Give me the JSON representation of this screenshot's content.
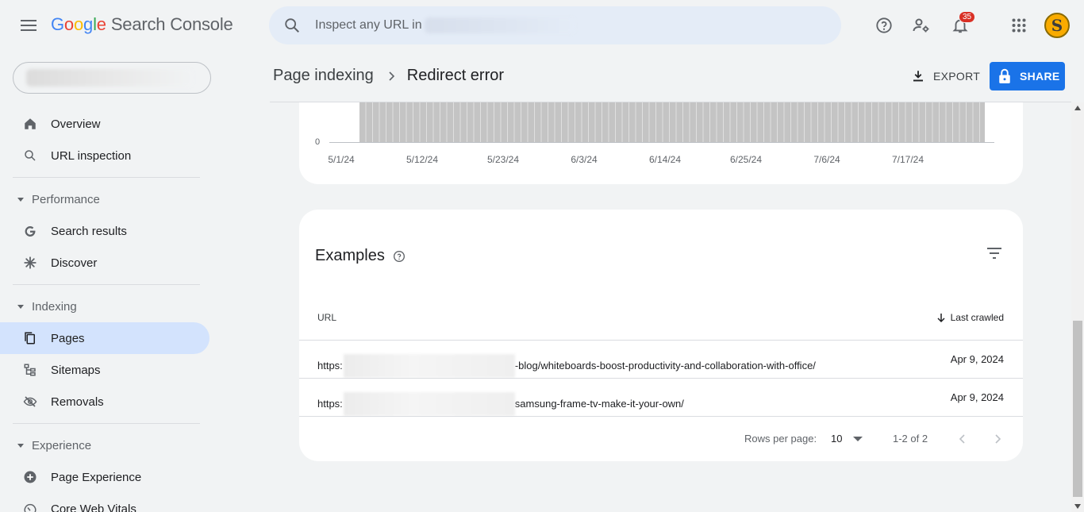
{
  "app": {
    "title_letters": [
      "G",
      "o",
      "o",
      "g",
      "l",
      "e"
    ],
    "product": "Search Console"
  },
  "search": {
    "placeholder": "Inspect any URL in"
  },
  "notifications": {
    "count": "35"
  },
  "avatar": {
    "initial": "S"
  },
  "icons": {
    "menu": "menu-icon",
    "search": "search-icon",
    "help": "help-icon",
    "account_settings": "manage-accounts-icon",
    "notifications": "bell-icon",
    "apps": "apps-grid-icon"
  },
  "sidebar": {
    "items": [
      {
        "label": "Overview",
        "icon": "home-icon"
      },
      {
        "label": "URL inspection",
        "icon": "search-icon"
      }
    ],
    "sections": [
      {
        "label": "Performance",
        "items": [
          {
            "label": "Search results",
            "icon": "google-g-icon"
          },
          {
            "label": "Discover",
            "icon": "asterisk-icon"
          }
        ]
      },
      {
        "label": "Indexing",
        "items": [
          {
            "label": "Pages",
            "icon": "pages-icon",
            "active": true
          },
          {
            "label": "Sitemaps",
            "icon": "sitemap-icon"
          },
          {
            "label": "Removals",
            "icon": "eye-off-icon"
          }
        ]
      },
      {
        "label": "Experience",
        "items": [
          {
            "label": "Page Experience",
            "icon": "plus-circle-icon"
          },
          {
            "label": "Core Web Vitals",
            "icon": "gauge-icon"
          }
        ]
      }
    ]
  },
  "header": {
    "breadcrumb_parent": "Page indexing",
    "breadcrumb_current": "Redirect error",
    "export_label": "EXPORT",
    "share_label": "SHARE"
  },
  "chart_data": {
    "type": "bar",
    "y_tick_labels": [
      "0"
    ],
    "x_tick_labels": [
      "5/1/24",
      "5/12/24",
      "5/23/24",
      "6/3/24",
      "6/14/24",
      "6/25/24",
      "7/6/24",
      "7/17/24"
    ]
  },
  "examples": {
    "title": "Examples",
    "columns": {
      "url": "URL",
      "last_crawled": "Last crawled"
    },
    "rows": [
      {
        "url_prefix": "https:",
        "url_suffix": "-blog/whiteboards-boost-productivity-and-collaboration-with-office/",
        "date": "Apr 9, 2024"
      },
      {
        "url_prefix": "https:",
        "url_suffix": "samsung-frame-tv-make-it-your-own/",
        "date": "Apr 9, 2024"
      }
    ],
    "pagination": {
      "rows_per_page_label": "Rows per page:",
      "rows_per_page_value": "10",
      "range": "1-2 of 2"
    }
  },
  "colors": {
    "accent": "#1a73e8",
    "active_nav_bg": "#d3e3fd",
    "badge": "#d93025",
    "page_bg": "#f1f3f4"
  }
}
